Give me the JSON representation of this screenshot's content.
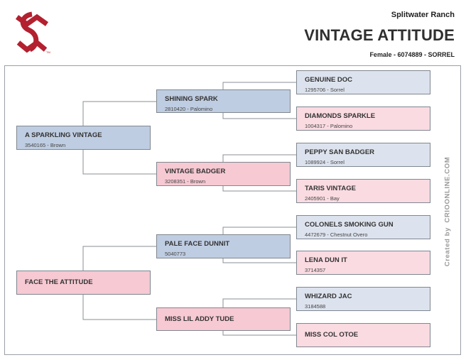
{
  "header": {
    "ranch": "Splitwater Ranch",
    "horse_name": "VINTAGE ATTITUDE",
    "details": "Female - 6074889 - SORREL"
  },
  "credit": {
    "prefix": "Created by",
    "site": "CRIOONLINE.COM"
  },
  "colors": {
    "brand_red": "#b3202f",
    "sire_fill": "#bfcde2",
    "dam_fill": "#f6c9d3",
    "sire_fill_light": "#dde3ee",
    "dam_fill_light": "#fadbe2"
  },
  "pedigree": {
    "sire": {
      "name": "A SPARKLING VINTAGE",
      "info": "3540165 - Brown"
    },
    "dam": {
      "name": "FACE THE ATTITUDE",
      "info": ""
    },
    "sire_sire": {
      "name": "SHINING SPARK",
      "info": "2810420 - Palomino"
    },
    "sire_dam": {
      "name": "VINTAGE BADGER",
      "info": "3208351 - Brown"
    },
    "dam_sire": {
      "name": "PALE FACE DUNNIT",
      "info": "5040773"
    },
    "dam_dam": {
      "name": "MISS LIL ADDY TUDE",
      "info": ""
    },
    "ggp": [
      {
        "name": "GENUINE DOC",
        "info": "1295706 - Sorrel"
      },
      {
        "name": "DIAMONDS SPARKLE",
        "info": "1004317 - Palomino"
      },
      {
        "name": "PEPPY SAN BADGER",
        "info": "1089924 - Sorrel"
      },
      {
        "name": "TARIS VINTAGE",
        "info": "2405901 - Bay"
      },
      {
        "name": "COLONELS SMOKING GUN",
        "info": "4472679 - Chestnut Overo"
      },
      {
        "name": "LENA DUN IT",
        "info": "3714357"
      },
      {
        "name": "WHIZARD JAC",
        "info": "3184588"
      },
      {
        "name": "MISS COL OTOE",
        "info": ""
      }
    ]
  }
}
